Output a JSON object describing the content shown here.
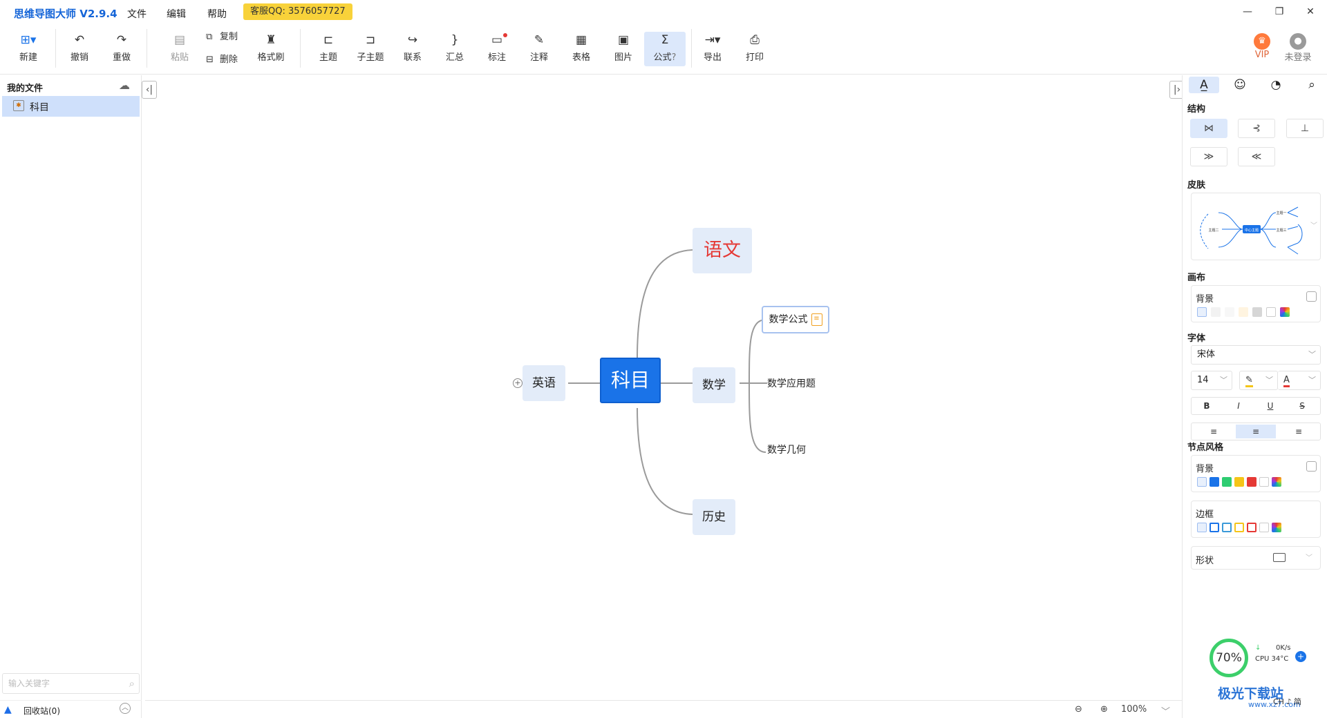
{
  "app": {
    "title": "思维导图大师 V2.9.4",
    "menu": [
      "文件",
      "编辑",
      "帮助"
    ],
    "support_badge": "客服QQ: 3576057727",
    "window_controls": {
      "minimize": "—",
      "restore": "❐",
      "close": "✕"
    },
    "vip_label": "VIP",
    "login_label": "未登录"
  },
  "toolbar": {
    "new": "新建",
    "undo": "撤销",
    "redo": "重做",
    "paste": "粘贴",
    "copy": "复制",
    "delete": "删除",
    "format_brush": "格式刷",
    "topic": "主题",
    "subtopic": "子主题",
    "relation": "联系",
    "summary": "汇总",
    "mark": "标注",
    "note": "注释",
    "table": "表格",
    "image": "图片",
    "formula": "公式",
    "export": "导出",
    "print": "打印"
  },
  "left_panel": {
    "title": "我的文件",
    "files": [
      {
        "name": "科目"
      }
    ],
    "search_placeholder": "输入关键字",
    "recycle_bin": "回收站(0)"
  },
  "mindmap": {
    "root": "科目",
    "branches": [
      {
        "label": "语文",
        "color": "#e53935"
      },
      {
        "label": "数学",
        "children": [
          "数学公式",
          "数学应用题",
          "数学几何"
        ]
      },
      {
        "label": "历史"
      },
      {
        "label": "英语"
      }
    ]
  },
  "status": {
    "zoom": "100%"
  },
  "right_panel": {
    "sections": {
      "structure": "结构",
      "skin": "皮肤",
      "canvas": "画布",
      "font": "字体",
      "node_style": "节点风格"
    },
    "skin_preview": {
      "center": "中心主题",
      "left_topic": "主题二",
      "topic_one": "主题一",
      "topic_three": "主题三"
    },
    "canvas_background_label": "背景",
    "font_family": "宋体",
    "font_size": "14",
    "text_format": [
      "B",
      "I",
      "U",
      "S"
    ],
    "node_background_label": "背景",
    "border_label": "边框",
    "shape_label": "形状",
    "colors": {
      "canvas": [
        "#f2f2f2",
        "#f7f7f7",
        "#fff4e0",
        "#d6d6d6"
      ],
      "node_bg": [
        "#1a73e8",
        "#2ecc71",
        "#f5c518",
        "#e53935"
      ],
      "border": [
        "#1a73e8",
        "#3a9ad9",
        "#f5c518",
        "#e53935"
      ]
    }
  },
  "widget": {
    "percent": "70%",
    "net_speed": "0K/s",
    "cpu": "CPU 34°C",
    "ime": "CH ♪ 简"
  },
  "watermark": {
    "name": "极光下载站",
    "url": "www.xz7.com"
  }
}
